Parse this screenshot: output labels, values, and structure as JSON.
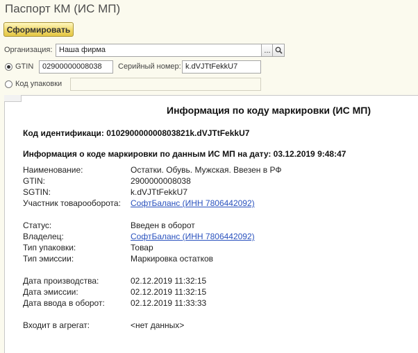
{
  "window": {
    "title": "Паспорт КМ (ИС МП)"
  },
  "toolbar": {
    "form_button": "Сформировать"
  },
  "form": {
    "organization_label": "Организация:",
    "organization_value": "Наша фирма",
    "select_button": "...",
    "gtin_label": "GTIN",
    "gtin_value": "02900000008038",
    "serial_label": "Серийный номер:",
    "serial_value": "k.dVJTtFekkU7",
    "package_label": "Код упаковки",
    "package_value": "",
    "selected_mode": "GTIN"
  },
  "report": {
    "title": "Информация по коду маркировки (ИС МП)",
    "code_line": "Код идентификаци: 010290000000803821k.dVJTtFekkU7",
    "info_line": "Информация о коде маркировки по данным ИС МП на дату: 03.12.2019 9:48:47",
    "rows": [
      {
        "key": "Наименование:",
        "value": "Остатки. Обувь. Мужская. Ввезен в РФ",
        "link": false
      },
      {
        "key": "GTIN:",
        "value": "2900000008038",
        "link": false
      },
      {
        "key": "SGTIN:",
        "value": "k.dVJTtFekkU7",
        "link": false
      },
      {
        "key": "Участник товарооборота:",
        "value": "СофтБаланс  (ИНН 7806442092)",
        "link": true
      },
      {
        "key": "Статус:",
        "value": "Введен в оборот",
        "link": false
      },
      {
        "key": "Владелец:",
        "value": "СофтБаланс  (ИНН 7806442092)",
        "link": true
      },
      {
        "key": "Тип упаковки:",
        "value": "Товар",
        "link": false
      },
      {
        "key": "Тип эмиссии:",
        "value": "Маркировка остатков",
        "link": false
      },
      {
        "key": "Дата производства:",
        "value": "02.12.2019 11:32:15",
        "link": false
      },
      {
        "key": "Дата эмиссии:",
        "value": "02.12.2019 11:32:15",
        "link": false
      },
      {
        "key": "Дата ввода в оборот:",
        "value": "02.12.2019 11:33:33",
        "link": false
      },
      {
        "key": "Входит в агрегат:",
        "value": "<нет данных>",
        "link": false
      }
    ]
  }
}
